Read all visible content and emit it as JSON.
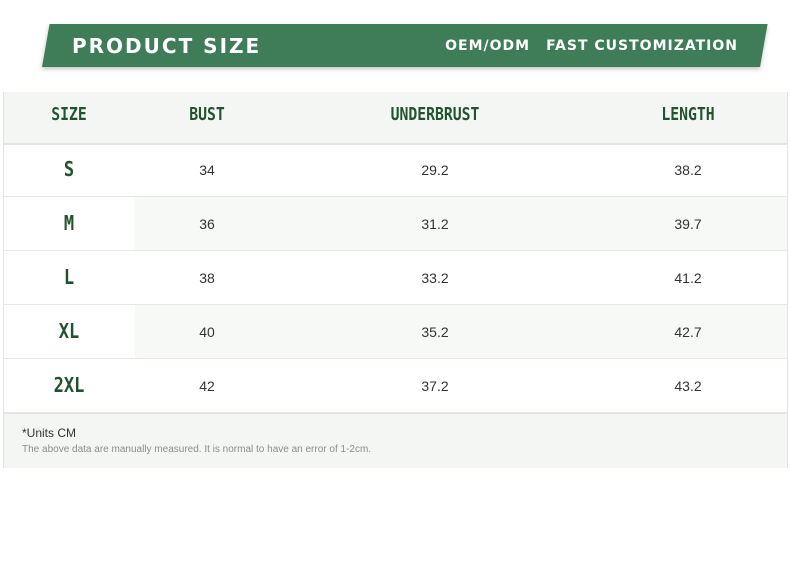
{
  "banner": {
    "title": "PRODUCT SIZE",
    "tag1": "OEM/ODM",
    "tag2": "FAST CUSTOMIZATION"
  },
  "table": {
    "headers": [
      "SIZE",
      "BUST",
      "UNDERBRUST",
      "LENGTH"
    ],
    "rows": [
      {
        "size": "S",
        "bust": "34",
        "underbust": "29.2",
        "length": "38.2"
      },
      {
        "size": "M",
        "bust": "36",
        "underbust": "31.2",
        "length": "39.7"
      },
      {
        "size": "L",
        "bust": "38",
        "underbust": "33.2",
        "length": "41.2"
      },
      {
        "size": "XL",
        "bust": "40",
        "underbust": "35.2",
        "length": "42.7"
      },
      {
        "size": "2XL",
        "bust": "42",
        "underbust": "37.2",
        "length": "43.2"
      }
    ]
  },
  "footer": {
    "unit": "*Units CM",
    "note": "The above data are manually measured. It is normal to have an error of 1-2cm."
  },
  "colors": {
    "brand_green": "#3e7d57",
    "header_text": "#22532f"
  }
}
